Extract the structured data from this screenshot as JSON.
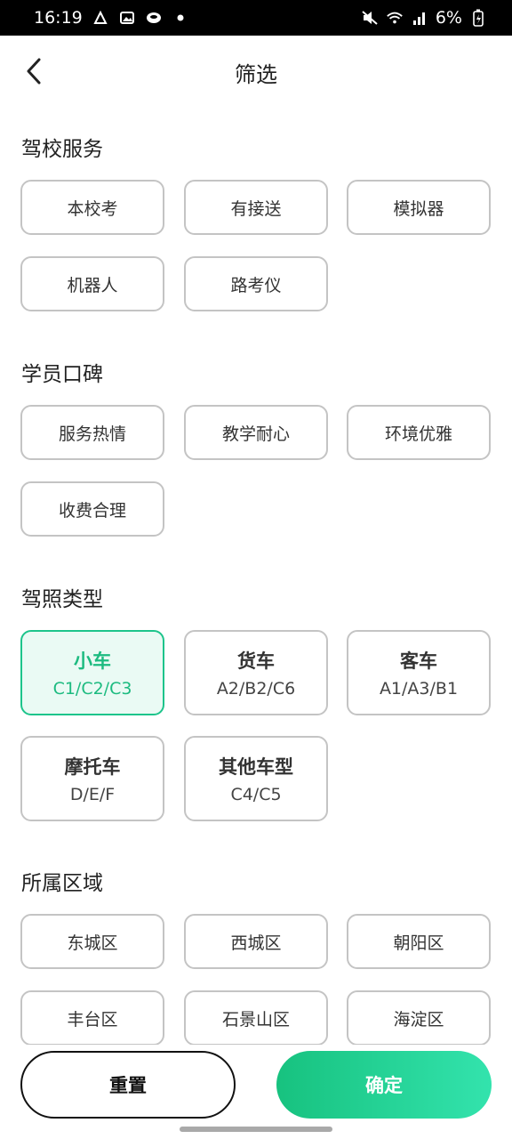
{
  "status_bar": {
    "time": "16:19",
    "battery": "6%"
  },
  "header": {
    "title": "筛选"
  },
  "sections": [
    {
      "title": "驾校服务",
      "options": [
        "本校考",
        "有接送",
        "模拟器",
        "机器人",
        "路考仪"
      ]
    },
    {
      "title": "学员口碑",
      "options": [
        "服务热情",
        "教学耐心",
        "环境优雅",
        "收费合理"
      ]
    },
    {
      "title": "驾照类型",
      "options": [
        {
          "name": "小车",
          "codes": "C1/C2/C3",
          "selected": true
        },
        {
          "name": "货车",
          "codes": "A2/B2/C6",
          "selected": false
        },
        {
          "name": "客车",
          "codes": "A1/A3/B1",
          "selected": false
        },
        {
          "name": "摩托车",
          "codes": "D/E/F",
          "selected": false
        },
        {
          "name": "其他车型",
          "codes": "C4/C5",
          "selected": false
        }
      ]
    },
    {
      "title": "所属区域",
      "options": [
        "东城区",
        "西城区",
        "朝阳区",
        "丰台区",
        "石景山区",
        "海淀区"
      ]
    }
  ],
  "footer": {
    "reset_label": "重置",
    "confirm_label": "确定"
  },
  "colors": {
    "accent": "#1dc48b",
    "selected_bg": "#eafaf4",
    "chip_border": "#c4c4c4"
  }
}
